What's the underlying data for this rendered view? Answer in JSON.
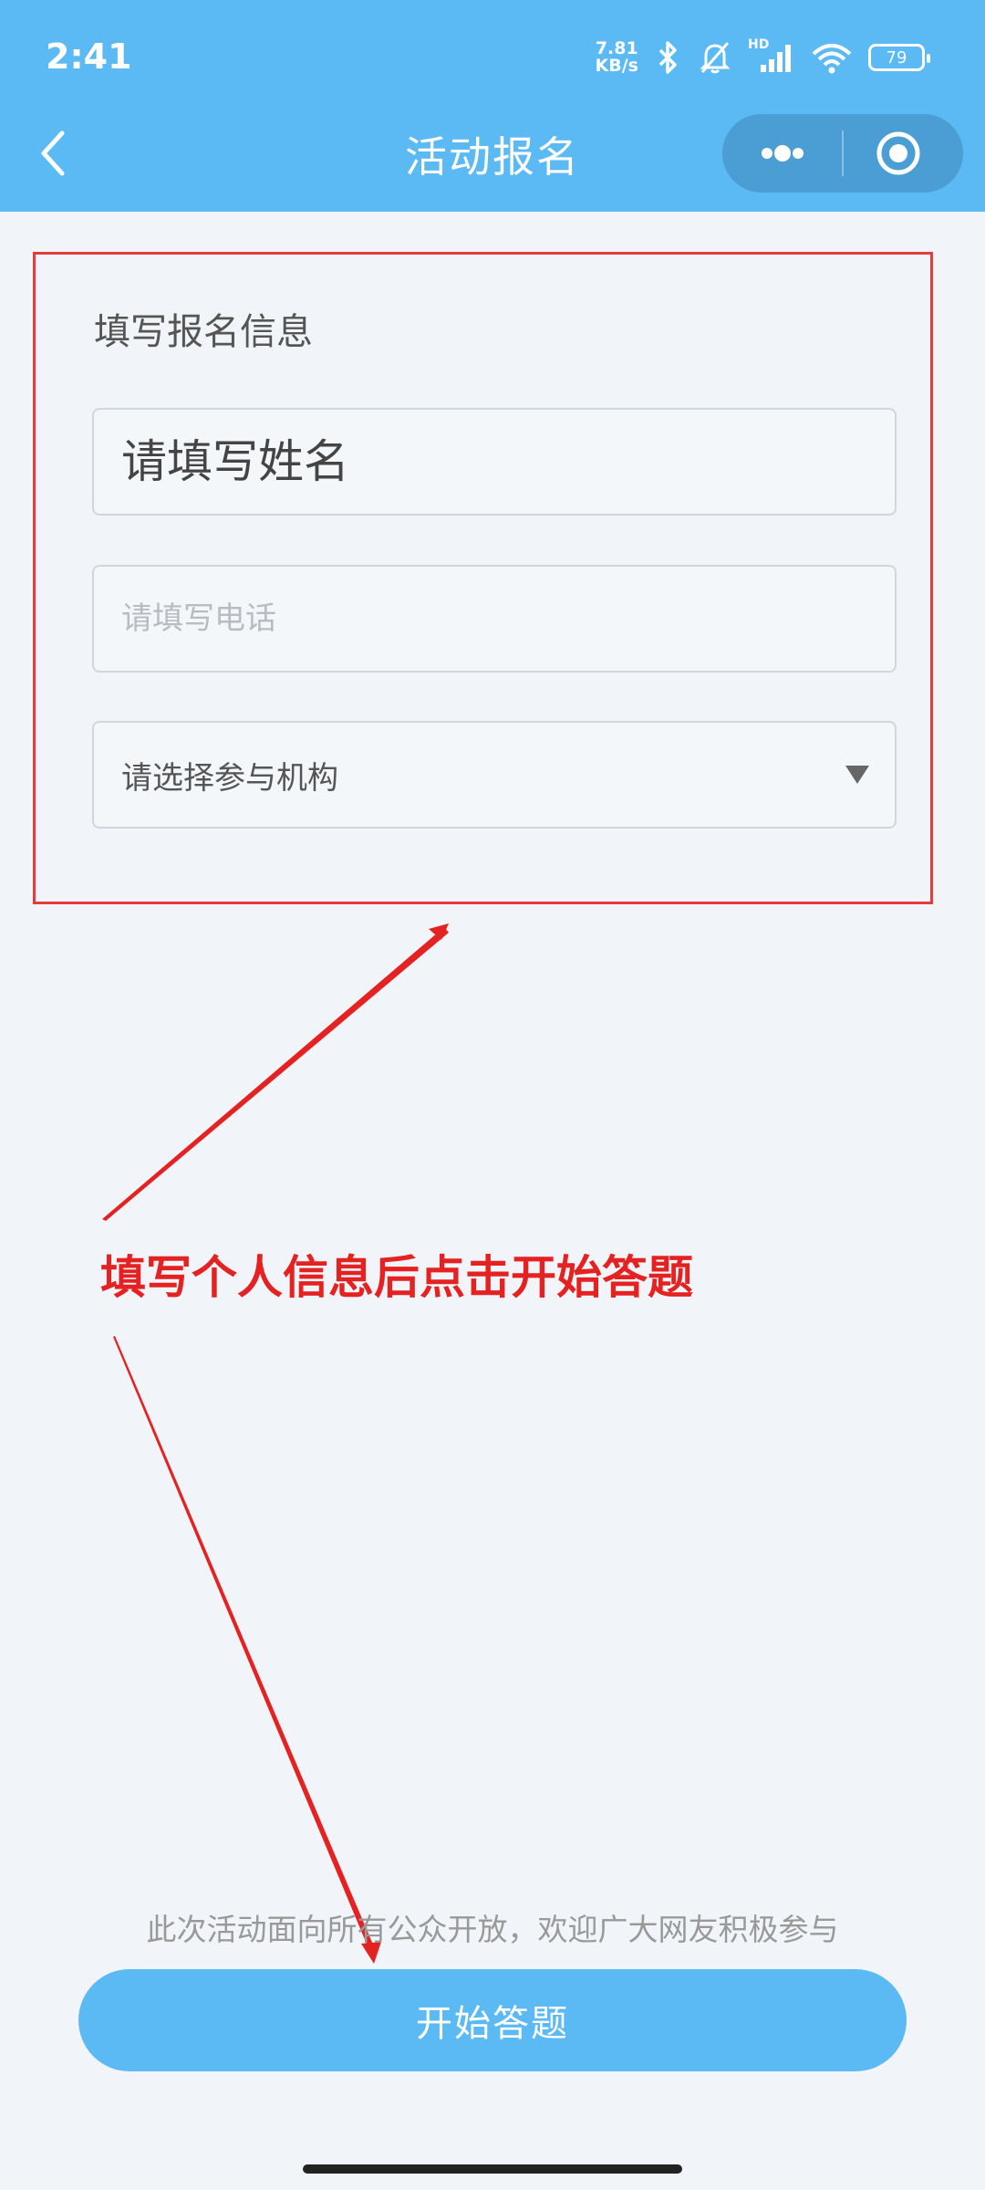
{
  "status_bar": {
    "time": "2:41",
    "net_speed_value": "7.81",
    "net_speed_unit": "KB/s",
    "hd_label": "HD",
    "battery": "79"
  },
  "nav": {
    "title": "活动报名"
  },
  "form": {
    "heading": "填写报名信息",
    "name_placeholder": "请填写姓名",
    "phone_placeholder": "请填写电话",
    "org_select": "请选择参与机构"
  },
  "annotation": {
    "text": "填写个人信息后点击开始答题"
  },
  "footer": {
    "note": "此次活动面向所有公众开放，欢迎广大网友积极参与",
    "start_button": "开始答题"
  },
  "colors": {
    "header_bg": "#5bb9f4",
    "page_bg": "#f1f5f9",
    "annotation_red": "#e52222",
    "button_bg": "#5bb9f4"
  },
  "icons": [
    "back-arrow-icon",
    "bluetooth-icon",
    "mute-bell-icon",
    "signal-icon",
    "wifi-icon",
    "more-dots-icon",
    "target-circle-icon",
    "dropdown-caret-icon"
  ]
}
